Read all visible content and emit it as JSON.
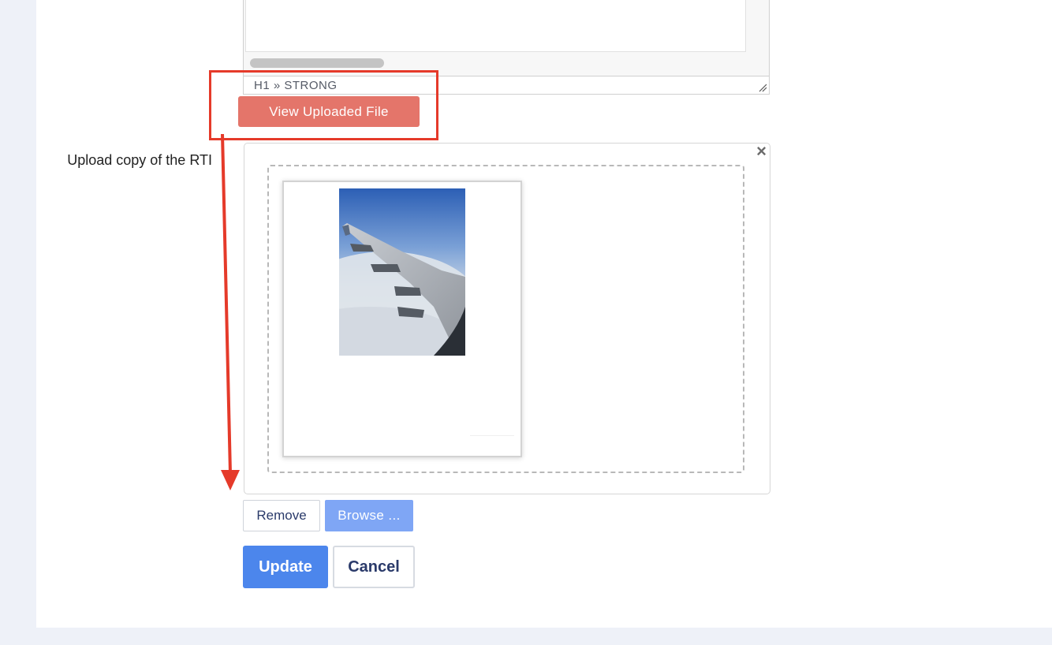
{
  "editor": {
    "status_path": "H1 » STRONG"
  },
  "view_button": {
    "label": "View Uploaded File",
    "color": "#e4756a"
  },
  "upload_field": {
    "label": "Upload copy of the RTI",
    "close_symbol": "×",
    "preview_image": "airplane-wing-photo"
  },
  "file_actions": {
    "remove_label": "Remove",
    "browse_label": "Browse ..."
  },
  "form_actions": {
    "update_label": "Update",
    "cancel_label": "Cancel",
    "accent_color": "#4c86ec"
  },
  "annotation": {
    "color": "#e53a2a",
    "icon": "arrow-down-icon"
  }
}
